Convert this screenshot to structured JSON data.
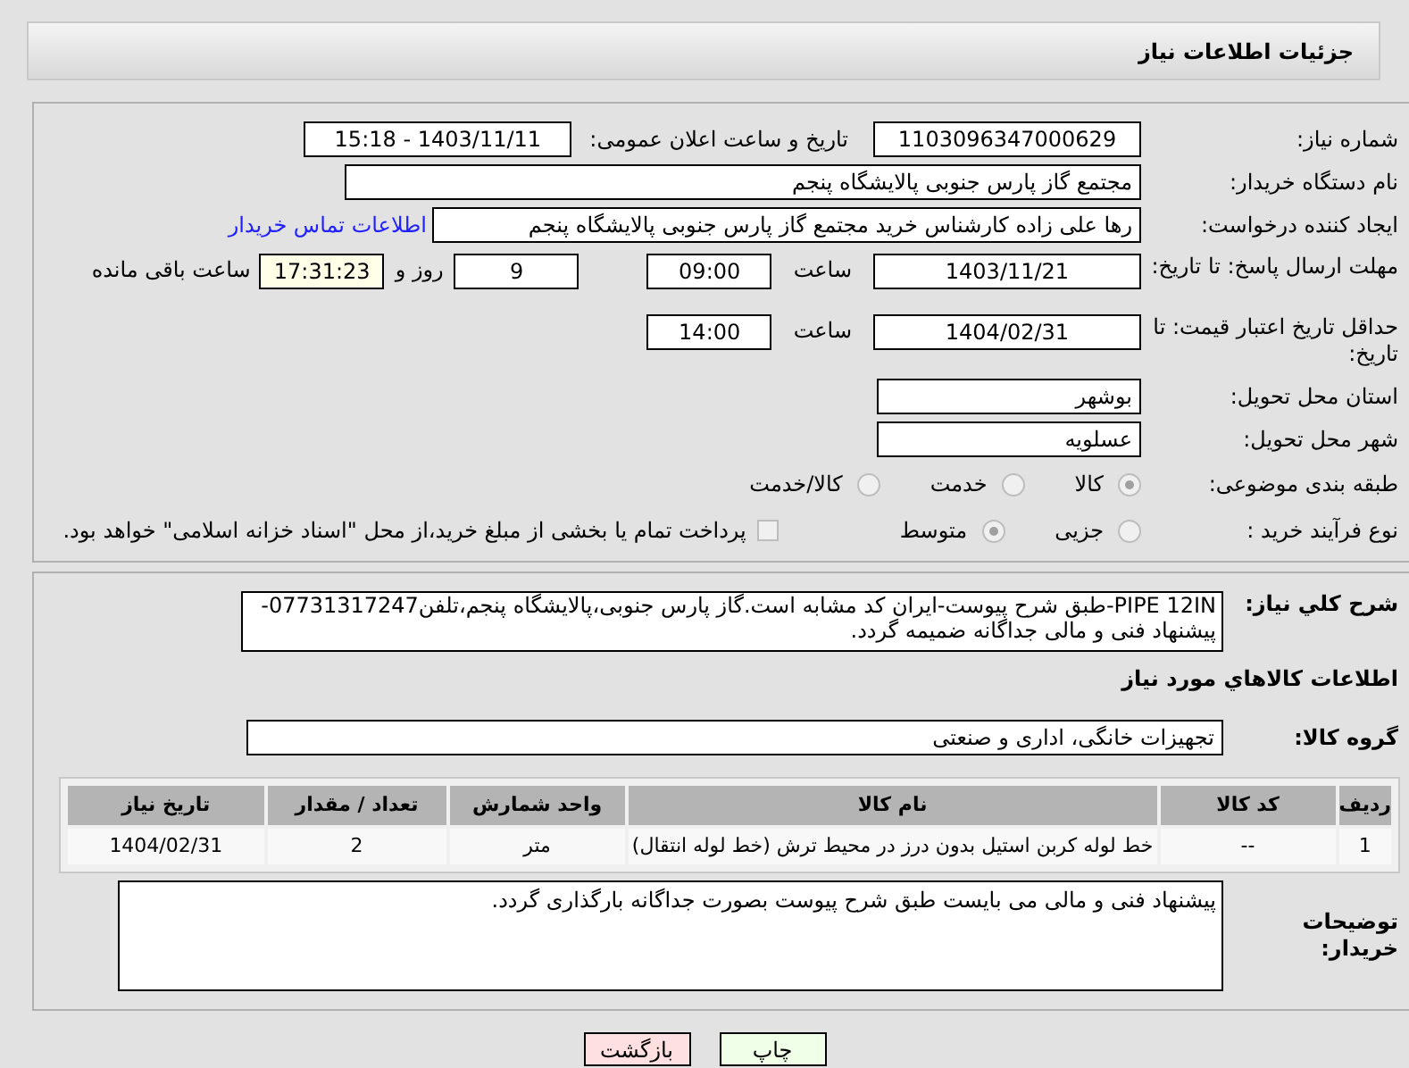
{
  "header": {
    "title": "جزئیات اطلاعات نیاز"
  },
  "need_number": {
    "label": "شماره نیاز:",
    "value": "1103096347000629"
  },
  "announce": {
    "label": "تاریخ و ساعت اعلان عمومی:",
    "value": "1403/11/11 - 15:18"
  },
  "buyer_org": {
    "label": "نام دستگاه خریدار:",
    "value": "مجتمع گاز پارس جنوبی  پالایشگاه پنجم"
  },
  "requester": {
    "label": "ایجاد کننده درخواست:",
    "value": "رها علی زاده کارشناس خرید مجتمع گاز پارس جنوبی  پالایشگاه پنجم",
    "link": "اطلاعات تماس خریدار"
  },
  "response_deadline": {
    "label": "مهلت ارسال پاسخ: تا تاریخ:",
    "date": "1403/11/21",
    "time_label": "ساعت",
    "time": "09:00",
    "days": "9",
    "days_label": "روز و",
    "remaining": "17:31:23",
    "remaining_label": "ساعت باقی مانده"
  },
  "price_validity": {
    "label": "حداقل تاریخ اعتبار قیمت: تا تاریخ:",
    "date": "1404/02/31",
    "time_label": "ساعت",
    "time": "14:00"
  },
  "province": {
    "label": "استان محل تحویل:",
    "value": "بوشهر"
  },
  "city": {
    "label": "شهر محل تحویل:",
    "value": "عسلویه"
  },
  "category": {
    "label": "طبقه بندی موضوعی:",
    "options": [
      {
        "label": "کالا",
        "selected": true
      },
      {
        "label": "خدمت",
        "selected": false
      },
      {
        "label": "کالا/خدمت",
        "selected": false
      }
    ]
  },
  "process": {
    "label": "نوع فرآیند خرید :",
    "options": [
      {
        "label": "جزیی",
        "selected": false
      },
      {
        "label": "متوسط",
        "selected": true
      }
    ],
    "payment": {
      "checked": false,
      "text": "پرداخت تمام یا بخشی از مبلغ خرید،از محل \"اسناد خزانه اسلامی\" خواهد بود."
    }
  },
  "summary": {
    "label": "شرح کلي نیاز:",
    "value": "PIPE 12IN-طبق شرح پیوست-ایران کد مشابه است.گاز پارس جنوبی،پالایشگاه پنجم،تلفن07731317247-پیشنهاد فنی و مالی جداگانه ضمیمه گردد."
  },
  "goods_heading": "اطلاعات کالاهاي مورد نیاز",
  "goods_group": {
    "label": "گروه کالا:",
    "value": "تجهیزات خانگی، اداری و صنعتی"
  },
  "table": {
    "columns": [
      "ردیف",
      "کد کالا",
      "نام کالا",
      "واحد شمارش",
      "تعداد / مقدار",
      "تاریخ نیاز"
    ],
    "rows": [
      [
        "1",
        "--",
        "خط لوله کربن استیل بدون درز در محیط ترش (خط لوله انتقال)",
        "متر",
        "2",
        "1404/02/31"
      ]
    ]
  },
  "buyer_notes": {
    "label": "توضیحات خریدار:",
    "value": "پیشنهاد فنی و مالی می بایست طبق شرح پیوست بصورت جداگانه بارگذاری گردد."
  },
  "buttons": [
    {
      "label": "چاپ",
      "kind": "print"
    },
    {
      "label": "بازگشت",
      "kind": "back"
    }
  ]
}
